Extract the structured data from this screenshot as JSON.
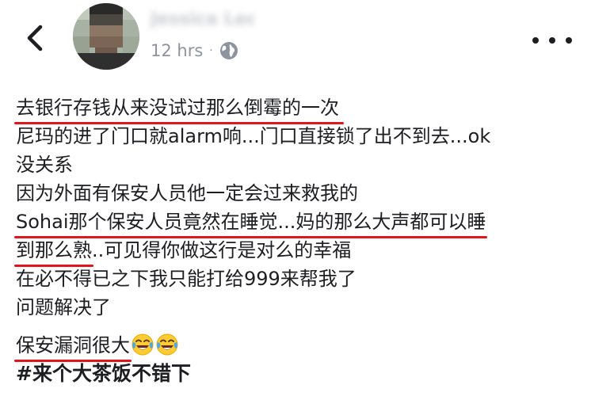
{
  "header": {
    "poster_name": "Jessica Lee",
    "timestamp": "12 hrs",
    "separator": "·",
    "privacy_icon": "globe-icon",
    "back_icon": "chevron-left-icon",
    "more_icon": "more-horizontal-icon"
  },
  "post": {
    "lines": [
      "去银行存钱从来没试过那么倒霉的一次",
      "尼玛的进了门口就alarm响...门口直接锁了出不到去...ok",
      "没关系",
      "因为外面有保安人员他一定会过来救我的",
      "Sohai那个保安人员竟然在睡觉...妈的那么大声都可以睡",
      "到那么熟",
      "..可见得你做这行是对么的幸福",
      "在必不得已之下我只能打给999来帮我了",
      "问题解决了",
      "保安漏洞很大",
      "#来个大茶饭不错下"
    ],
    "emoji": "face-with-tears-of-joy-icon"
  },
  "colors": {
    "underline": "#e1161f",
    "text": "#1c1e21",
    "meta": "#8d949e"
  }
}
